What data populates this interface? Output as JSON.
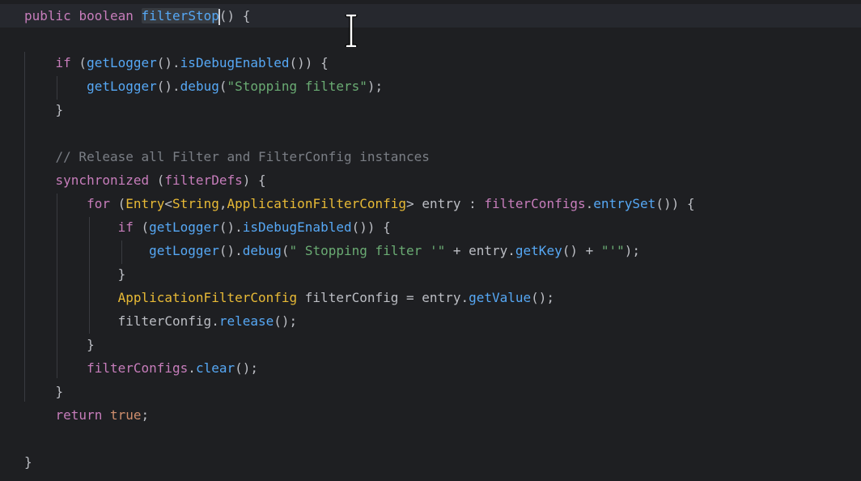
{
  "code": {
    "lines": [
      {
        "tokens": [
          {
            "t": "public",
            "c": "kw2"
          },
          {
            "t": " ",
            "c": "plain"
          },
          {
            "t": "boolean",
            "c": "kw2"
          },
          {
            "t": " ",
            "c": "plain"
          },
          {
            "t": "filterStop",
            "c": "hl"
          },
          {
            "t": "() {",
            "c": "plain"
          }
        ]
      },
      {
        "tokens": []
      },
      {
        "tokens": [
          {
            "t": "    ",
            "c": "plain"
          },
          {
            "t": "if",
            "c": "kw2"
          },
          {
            "t": " (",
            "c": "plain"
          },
          {
            "t": "getLogger",
            "c": "fn"
          },
          {
            "t": "().",
            "c": "plain"
          },
          {
            "t": "isDebugEnabled",
            "c": "fn"
          },
          {
            "t": "()) {",
            "c": "plain"
          }
        ]
      },
      {
        "tokens": [
          {
            "t": "        ",
            "c": "plain"
          },
          {
            "t": "getLogger",
            "c": "fn"
          },
          {
            "t": "().",
            "c": "plain"
          },
          {
            "t": "debug",
            "c": "fn"
          },
          {
            "t": "(",
            "c": "plain"
          },
          {
            "t": "\"Stopping filters\"",
            "c": "str"
          },
          {
            "t": ");",
            "c": "plain"
          }
        ]
      },
      {
        "tokens": [
          {
            "t": "    }",
            "c": "plain"
          }
        ]
      },
      {
        "tokens": []
      },
      {
        "tokens": [
          {
            "t": "    ",
            "c": "plain"
          },
          {
            "t": "// Release all Filter and FilterConfig instances",
            "c": "cmt"
          }
        ]
      },
      {
        "tokens": [
          {
            "t": "    ",
            "c": "plain"
          },
          {
            "t": "synchronized",
            "c": "kw2"
          },
          {
            "t": " (",
            "c": "plain"
          },
          {
            "t": "filterDefs",
            "c": "fld"
          },
          {
            "t": ") {",
            "c": "plain"
          }
        ]
      },
      {
        "tokens": [
          {
            "t": "        ",
            "c": "plain"
          },
          {
            "t": "for",
            "c": "kw2"
          },
          {
            "t": " (",
            "c": "plain"
          },
          {
            "t": "Entry",
            "c": "cls"
          },
          {
            "t": "<",
            "c": "plain"
          },
          {
            "t": "String",
            "c": "cls"
          },
          {
            "t": ",",
            "c": "plain"
          },
          {
            "t": "ApplicationFilterConfig",
            "c": "cls"
          },
          {
            "t": "> entry : ",
            "c": "plain"
          },
          {
            "t": "filterConfigs",
            "c": "fld"
          },
          {
            "t": ".",
            "c": "plain"
          },
          {
            "t": "entrySet",
            "c": "fn"
          },
          {
            "t": "()) {",
            "c": "plain"
          }
        ]
      },
      {
        "tokens": [
          {
            "t": "            ",
            "c": "plain"
          },
          {
            "t": "if",
            "c": "kw2"
          },
          {
            "t": " (",
            "c": "plain"
          },
          {
            "t": "getLogger",
            "c": "fn"
          },
          {
            "t": "().",
            "c": "plain"
          },
          {
            "t": "isDebugEnabled",
            "c": "fn"
          },
          {
            "t": "()) {",
            "c": "plain"
          }
        ]
      },
      {
        "tokens": [
          {
            "t": "                ",
            "c": "plain"
          },
          {
            "t": "getLogger",
            "c": "fn"
          },
          {
            "t": "().",
            "c": "plain"
          },
          {
            "t": "debug",
            "c": "fn"
          },
          {
            "t": "(",
            "c": "plain"
          },
          {
            "t": "\" Stopping filter '\"",
            "c": "str"
          },
          {
            "t": " + entry.",
            "c": "plain"
          },
          {
            "t": "getKey",
            "c": "fn"
          },
          {
            "t": "() + ",
            "c": "plain"
          },
          {
            "t": "\"'\"",
            "c": "str"
          },
          {
            "t": ");",
            "c": "plain"
          }
        ]
      },
      {
        "tokens": [
          {
            "t": "            }",
            "c": "plain"
          }
        ]
      },
      {
        "tokens": [
          {
            "t": "            ",
            "c": "plain"
          },
          {
            "t": "ApplicationFilterConfig",
            "c": "cls"
          },
          {
            "t": " filterConfig = entry.",
            "c": "plain"
          },
          {
            "t": "getValue",
            "c": "fn"
          },
          {
            "t": "();",
            "c": "plain"
          }
        ]
      },
      {
        "tokens": [
          {
            "t": "            filterConfig.",
            "c": "plain"
          },
          {
            "t": "release",
            "c": "fn"
          },
          {
            "t": "();",
            "c": "plain"
          }
        ]
      },
      {
        "tokens": [
          {
            "t": "        }",
            "c": "plain"
          }
        ]
      },
      {
        "tokens": [
          {
            "t": "        ",
            "c": "plain"
          },
          {
            "t": "filterConfigs",
            "c": "fld"
          },
          {
            "t": ".",
            "c": "plain"
          },
          {
            "t": "clear",
            "c": "fn"
          },
          {
            "t": "();",
            "c": "plain"
          }
        ]
      },
      {
        "tokens": [
          {
            "t": "    }",
            "c": "plain"
          }
        ]
      },
      {
        "tokens": [
          {
            "t": "    ",
            "c": "plain"
          },
          {
            "t": "return",
            "c": "kw2"
          },
          {
            "t": " ",
            "c": "plain"
          },
          {
            "t": "true",
            "c": "kw"
          },
          {
            "t": ";",
            "c": "plain"
          }
        ]
      },
      {
        "tokens": []
      },
      {
        "tokens": [
          {
            "t": "}",
            "c": "plain"
          }
        ]
      }
    ]
  },
  "colors": {
    "background": "#1e1f22",
    "current_line": "#26282e",
    "keyword": "#c77dbb",
    "function": "#56a8f5",
    "string": "#6aab73",
    "class": "#e8ba36",
    "comment": "#7a7e85",
    "text": "#bcbec4"
  },
  "cursor": {
    "icon": "text-ibeam-cursor-icon"
  }
}
